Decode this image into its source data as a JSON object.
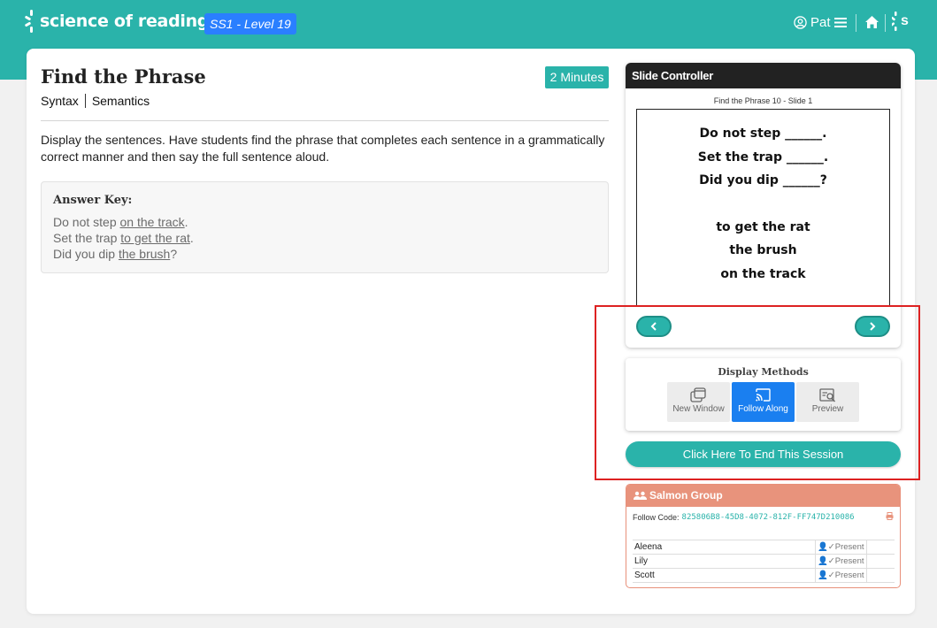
{
  "header": {
    "brand": "science of reading",
    "level_badge": "SS1 - Level 19",
    "user_name": "Pat",
    "logo_letter": "s",
    "colors": {
      "teal": "#2ab3aa",
      "badge_blue": "#2a7fff"
    }
  },
  "activity": {
    "title": "Find the Phrase",
    "duration": "2 Minutes",
    "tags": [
      "Syntax",
      "Semantics"
    ],
    "description": "Display the sentences. Have students find the phrase that completes each sentence in a grammatically correct manner and then say the full sentence aloud.",
    "answer_key": {
      "title": "Answer Key:",
      "lines": [
        {
          "before": "Do not step ",
          "answer": "on the track",
          "after": "."
        },
        {
          "before": "Set the trap ",
          "answer": "to get the rat",
          "after": "."
        },
        {
          "before": "Did you dip ",
          "answer": "the brush",
          "after": "?"
        }
      ]
    }
  },
  "slide_controller": {
    "title": "Slide Controller",
    "caption": "Find the Phrase 10 - Slide 1",
    "sentences": [
      "Do not step ______.",
      "Set the trap ______.",
      "Did you dip ______?"
    ],
    "phrases": [
      "to get the rat",
      "the brush",
      "on the track"
    ],
    "prev_icon": "chevron-left-icon",
    "next_icon": "chevron-right-icon"
  },
  "display_methods": {
    "title": "Display Methods",
    "options": [
      {
        "label": "New Window",
        "icon": "new-window-icon",
        "active": false
      },
      {
        "label": "Follow Along",
        "icon": "cast-icon",
        "active": true
      },
      {
        "label": "Preview",
        "icon": "preview-icon",
        "active": false
      }
    ],
    "active_color": "#1a7ff0"
  },
  "end_session": {
    "label": "Click Here To End This Session"
  },
  "group": {
    "name": "Salmon Group",
    "follow_code_label": "Follow Code:",
    "follow_code": "825806B8-45D8-4072-812F-FF747D210086",
    "students": [
      {
        "name": "Aleena",
        "status": "Present"
      },
      {
        "name": "Lily",
        "status": "Present"
      },
      {
        "name": "Scott",
        "status": "Present"
      }
    ],
    "header_color": "#e8937c"
  }
}
